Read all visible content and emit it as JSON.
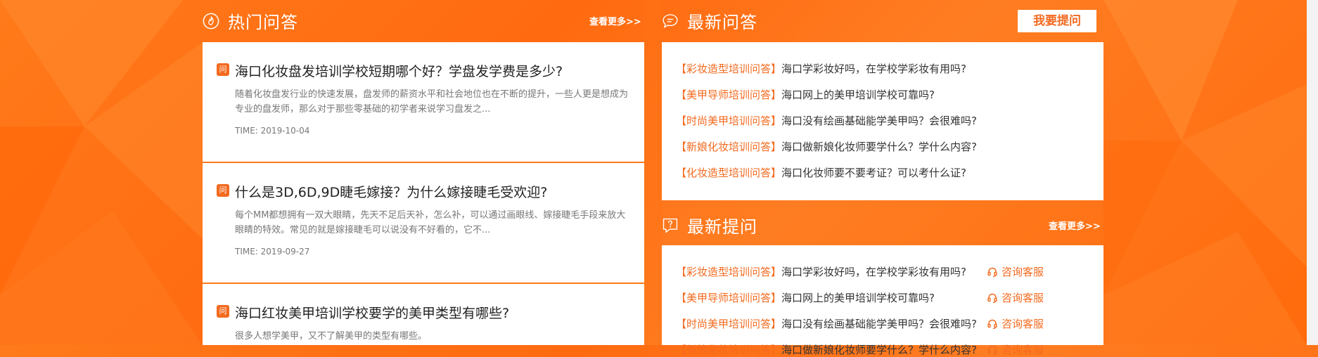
{
  "hot": {
    "title": "热门问答",
    "more": "查看更多>>",
    "items": [
      {
        "badge": "问",
        "title": "海口化妆盘发培训学校短期哪个好？学盘发学费是多少?",
        "desc": "随着化妆盘发行业的快速发展，盘发师的薪资水平和社会地位也在不断的提升，一些人更是想成为专业的盘发师，那么对于那些零基础的初学者来说学习盘发之...",
        "time": "TIME: 2019-10-04"
      },
      {
        "badge": "问",
        "title": "什么是3D,6D,9D睫毛嫁接？为什么嫁接睫毛受欢迎?",
        "desc": "每个MM都想拥有一双大眼睛，先天不足后天补，怎么补，可以通过画眼线、嫁接睫毛手段来放大眼睛的特效。常见的就是嫁接睫毛可以说没有不好看的，它不...",
        "time": "TIME: 2019-09-27"
      },
      {
        "badge": "问",
        "title": "海口红妆美甲培训学校要学的美甲类型有哪些?",
        "desc": "很多人想学美甲，又不了解美甲的类型有哪些。",
        "time": ""
      }
    ]
  },
  "latest": {
    "title": "最新问答",
    "ask_button": "我要提问",
    "items": [
      {
        "tag": "【彩妆造型培训问答】",
        "text": "海口学彩妆好吗，在学校学彩妆有用吗?"
      },
      {
        "tag": "【美甲导师培训问答】",
        "text": "海口网上的美甲培训学校可靠吗?"
      },
      {
        "tag": "【时尚美甲培训问答】",
        "text": "海口没有绘画基础能学美甲吗？会很难吗?"
      },
      {
        "tag": "【新娘化妆培训问答】",
        "text": "海口做新娘化妆师要学什么？学什么内容?"
      },
      {
        "tag": "【化妆造型培训问答】",
        "text": "海口化妆师要不要考证？可以考什么证?"
      }
    ]
  },
  "newest": {
    "title": "最新提问",
    "more": "查看更多>>",
    "consult_label": "咨询客服",
    "items": [
      {
        "tag": "【彩妆造型培训问答】",
        "text": "海口学彩妆好吗，在学校学彩妆有用吗?"
      },
      {
        "tag": "【美甲导师培训问答】",
        "text": "海口网上的美甲培训学校可靠吗?"
      },
      {
        "tag": "【时尚美甲培训问答】",
        "text": "海口没有绘画基础能学美甲吗？会很难吗?"
      },
      {
        "tag": "【新娘化妆培训问答】",
        "text": "海口做新娘化妆师要学什么？学什么内容?"
      }
    ]
  },
  "colors": {
    "accent": "#f36a1f",
    "background": "#ff7315"
  }
}
